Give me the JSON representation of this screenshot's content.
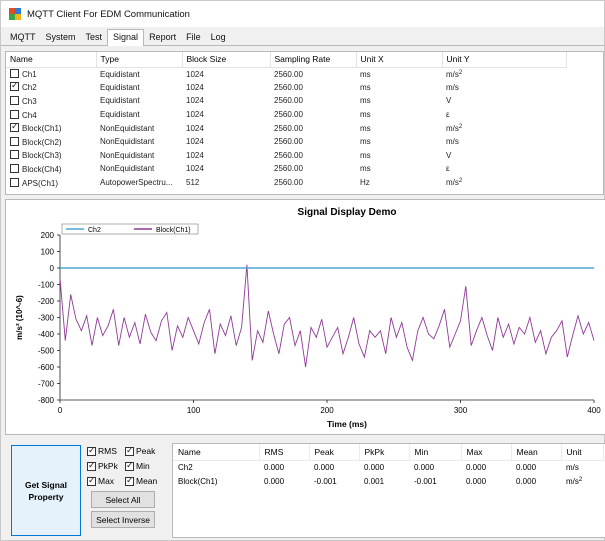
{
  "window": {
    "title": "MQTT Client For EDM Communication"
  },
  "menu": {
    "tabs": [
      {
        "label": "MQTT",
        "active": false
      },
      {
        "label": "System",
        "active": false
      },
      {
        "label": "Test",
        "active": false
      },
      {
        "label": "Signal",
        "active": true
      },
      {
        "label": "Report",
        "active": false
      },
      {
        "label": "File",
        "active": false
      },
      {
        "label": "Log",
        "active": false
      }
    ]
  },
  "signals": {
    "columns": [
      "Name",
      "Type",
      "Block Size",
      "Sampling Rate",
      "Unit X",
      "Unit Y"
    ],
    "rows": [
      {
        "checked": false,
        "name": "Ch1",
        "type": "Equidistant",
        "block_size": "1024",
        "sampling_rate": "2560.00",
        "unit_x": "ms",
        "unit_y": "m/s",
        "unit_y_sup": "2"
      },
      {
        "checked": true,
        "name": "Ch2",
        "type": "Equidistant",
        "block_size": "1024",
        "sampling_rate": "2560.00",
        "unit_x": "ms",
        "unit_y": "m/s",
        "unit_y_sup": ""
      },
      {
        "checked": false,
        "name": "Ch3",
        "type": "Equidistant",
        "block_size": "1024",
        "sampling_rate": "2560.00",
        "unit_x": "ms",
        "unit_y": "V",
        "unit_y_sup": ""
      },
      {
        "checked": false,
        "name": "Ch4",
        "type": "Equidistant",
        "block_size": "1024",
        "sampling_rate": "2560.00",
        "unit_x": "ms",
        "unit_y": "ε",
        "unit_y_sup": ""
      },
      {
        "checked": true,
        "name": "Block(Ch1)",
        "type": "NonEquidistant",
        "block_size": "1024",
        "sampling_rate": "2560.00",
        "unit_x": "ms",
        "unit_y": "m/s",
        "unit_y_sup": "2"
      },
      {
        "checked": false,
        "name": "Block(Ch2)",
        "type": "NonEquidistant",
        "block_size": "1024",
        "sampling_rate": "2560.00",
        "unit_x": "ms",
        "unit_y": "m/s",
        "unit_y_sup": ""
      },
      {
        "checked": false,
        "name": "Block(Ch3)",
        "type": "NonEquidistant",
        "block_size": "1024",
        "sampling_rate": "2560.00",
        "unit_x": "ms",
        "unit_y": "V",
        "unit_y_sup": ""
      },
      {
        "checked": false,
        "name": "Block(Ch4)",
        "type": "NonEquidistant",
        "block_size": "1024",
        "sampling_rate": "2560.00",
        "unit_x": "ms",
        "unit_y": "ε",
        "unit_y_sup": ""
      },
      {
        "checked": false,
        "name": "APS(Ch1)",
        "type": "AutopowerSpectru...",
        "block_size": "512",
        "sampling_rate": "2560.00",
        "unit_x": "Hz",
        "unit_y": "m/s",
        "unit_y_sup": "2"
      }
    ]
  },
  "chart_data": {
    "type": "line",
    "title": "Signal Display Demo",
    "xlabel": "Time (ms)",
    "ylabel": "m/s² (10^-6)",
    "xlim": [
      0,
      400
    ],
    "ylim": [
      -800,
      200
    ],
    "xticks": [
      0,
      100,
      200,
      300,
      400
    ],
    "yticks": [
      200,
      100,
      0,
      -100,
      -200,
      -300,
      -400,
      -500,
      -600,
      -700,
      -800
    ],
    "grid": false,
    "legend_position": "top-left",
    "series": [
      {
        "name": "Ch2",
        "color": "#4da6d6",
        "x": [
          0,
          400
        ],
        "y": [
          0,
          0
        ]
      },
      {
        "name": "Block(Ch1)",
        "color": "#8e3a96",
        "x": [
          0,
          4,
          8,
          12,
          16,
          20,
          24,
          28,
          32,
          36,
          40,
          44,
          48,
          52,
          56,
          60,
          64,
          68,
          72,
          76,
          80,
          84,
          88,
          92,
          96,
          100,
          104,
          108,
          112,
          116,
          120,
          124,
          128,
          132,
          136,
          140,
          144,
          148,
          152,
          156,
          160,
          164,
          168,
          172,
          176,
          180,
          184,
          188,
          192,
          196,
          200,
          204,
          208,
          212,
          216,
          220,
          224,
          228,
          232,
          236,
          240,
          244,
          248,
          252,
          256,
          260,
          264,
          268,
          272,
          276,
          280,
          284,
          288,
          292,
          296,
          300,
          304,
          308,
          312,
          316,
          320,
          324,
          328,
          332,
          336,
          340,
          344,
          348,
          352,
          356,
          360,
          364,
          368,
          372,
          376,
          380,
          384,
          388,
          392,
          396,
          400
        ],
        "y": [
          -60,
          -440,
          -160,
          -310,
          -380,
          -290,
          -470,
          -300,
          -410,
          -350,
          -250,
          -470,
          -300,
          -420,
          -330,
          -460,
          -280,
          -390,
          -440,
          -320,
          -270,
          -500,
          -350,
          -420,
          -300,
          -380,
          -460,
          -330,
          -250,
          -520,
          -340,
          -410,
          -290,
          -470,
          -360,
          20,
          -560,
          -380,
          -450,
          -260,
          -400,
          -520,
          -340,
          -300,
          -470,
          -380,
          -600,
          -360,
          -420,
          -310,
          -480,
          -420,
          -360,
          -520,
          -420,
          -300,
          -460,
          -540,
          -380,
          -420,
          -380,
          -520,
          -300,
          -420,
          -330,
          -480,
          -560,
          -380,
          -300,
          -400,
          -430,
          -350,
          -250,
          -480,
          -400,
          -320,
          -110,
          -470,
          -380,
          -300,
          -410,
          -500,
          -300,
          -420,
          -340,
          -460,
          -360,
          -400,
          -300,
          -450,
          -380,
          -520,
          -420,
          -380,
          -320,
          -540,
          -410,
          -290,
          -400,
          -330,
          -440
        ]
      }
    ]
  },
  "property_panel": {
    "get_button": "Get Signal Property",
    "checks": [
      {
        "label": "RMS",
        "checked": true
      },
      {
        "label": "Peak",
        "checked": true
      },
      {
        "label": "PkPk",
        "checked": true
      },
      {
        "label": "Min",
        "checked": true
      },
      {
        "label": "Max",
        "checked": true
      },
      {
        "label": "Mean",
        "checked": true
      }
    ],
    "select_all": "Select All",
    "select_inverse": "Select Inverse"
  },
  "stats": {
    "columns": [
      "Name",
      "RMS",
      "Peak",
      "PkPk",
      "Min",
      "Max",
      "Mean",
      "Unit"
    ],
    "rows": [
      {
        "name": "Ch2",
        "rms": "0.000",
        "peak": "0.000",
        "pkpk": "0.000",
        "min": "0.000",
        "max": "0.000",
        "mean": "0.000",
        "unit": "m/s",
        "unit_sup": ""
      },
      {
        "name": "Block(Ch1)",
        "rms": "0.000",
        "peak": "-0.001",
        "pkpk": "0.001",
        "min": "-0.001",
        "max": "0.000",
        "mean": "0.000",
        "unit": "m/s",
        "unit_sup": "2"
      }
    ]
  }
}
